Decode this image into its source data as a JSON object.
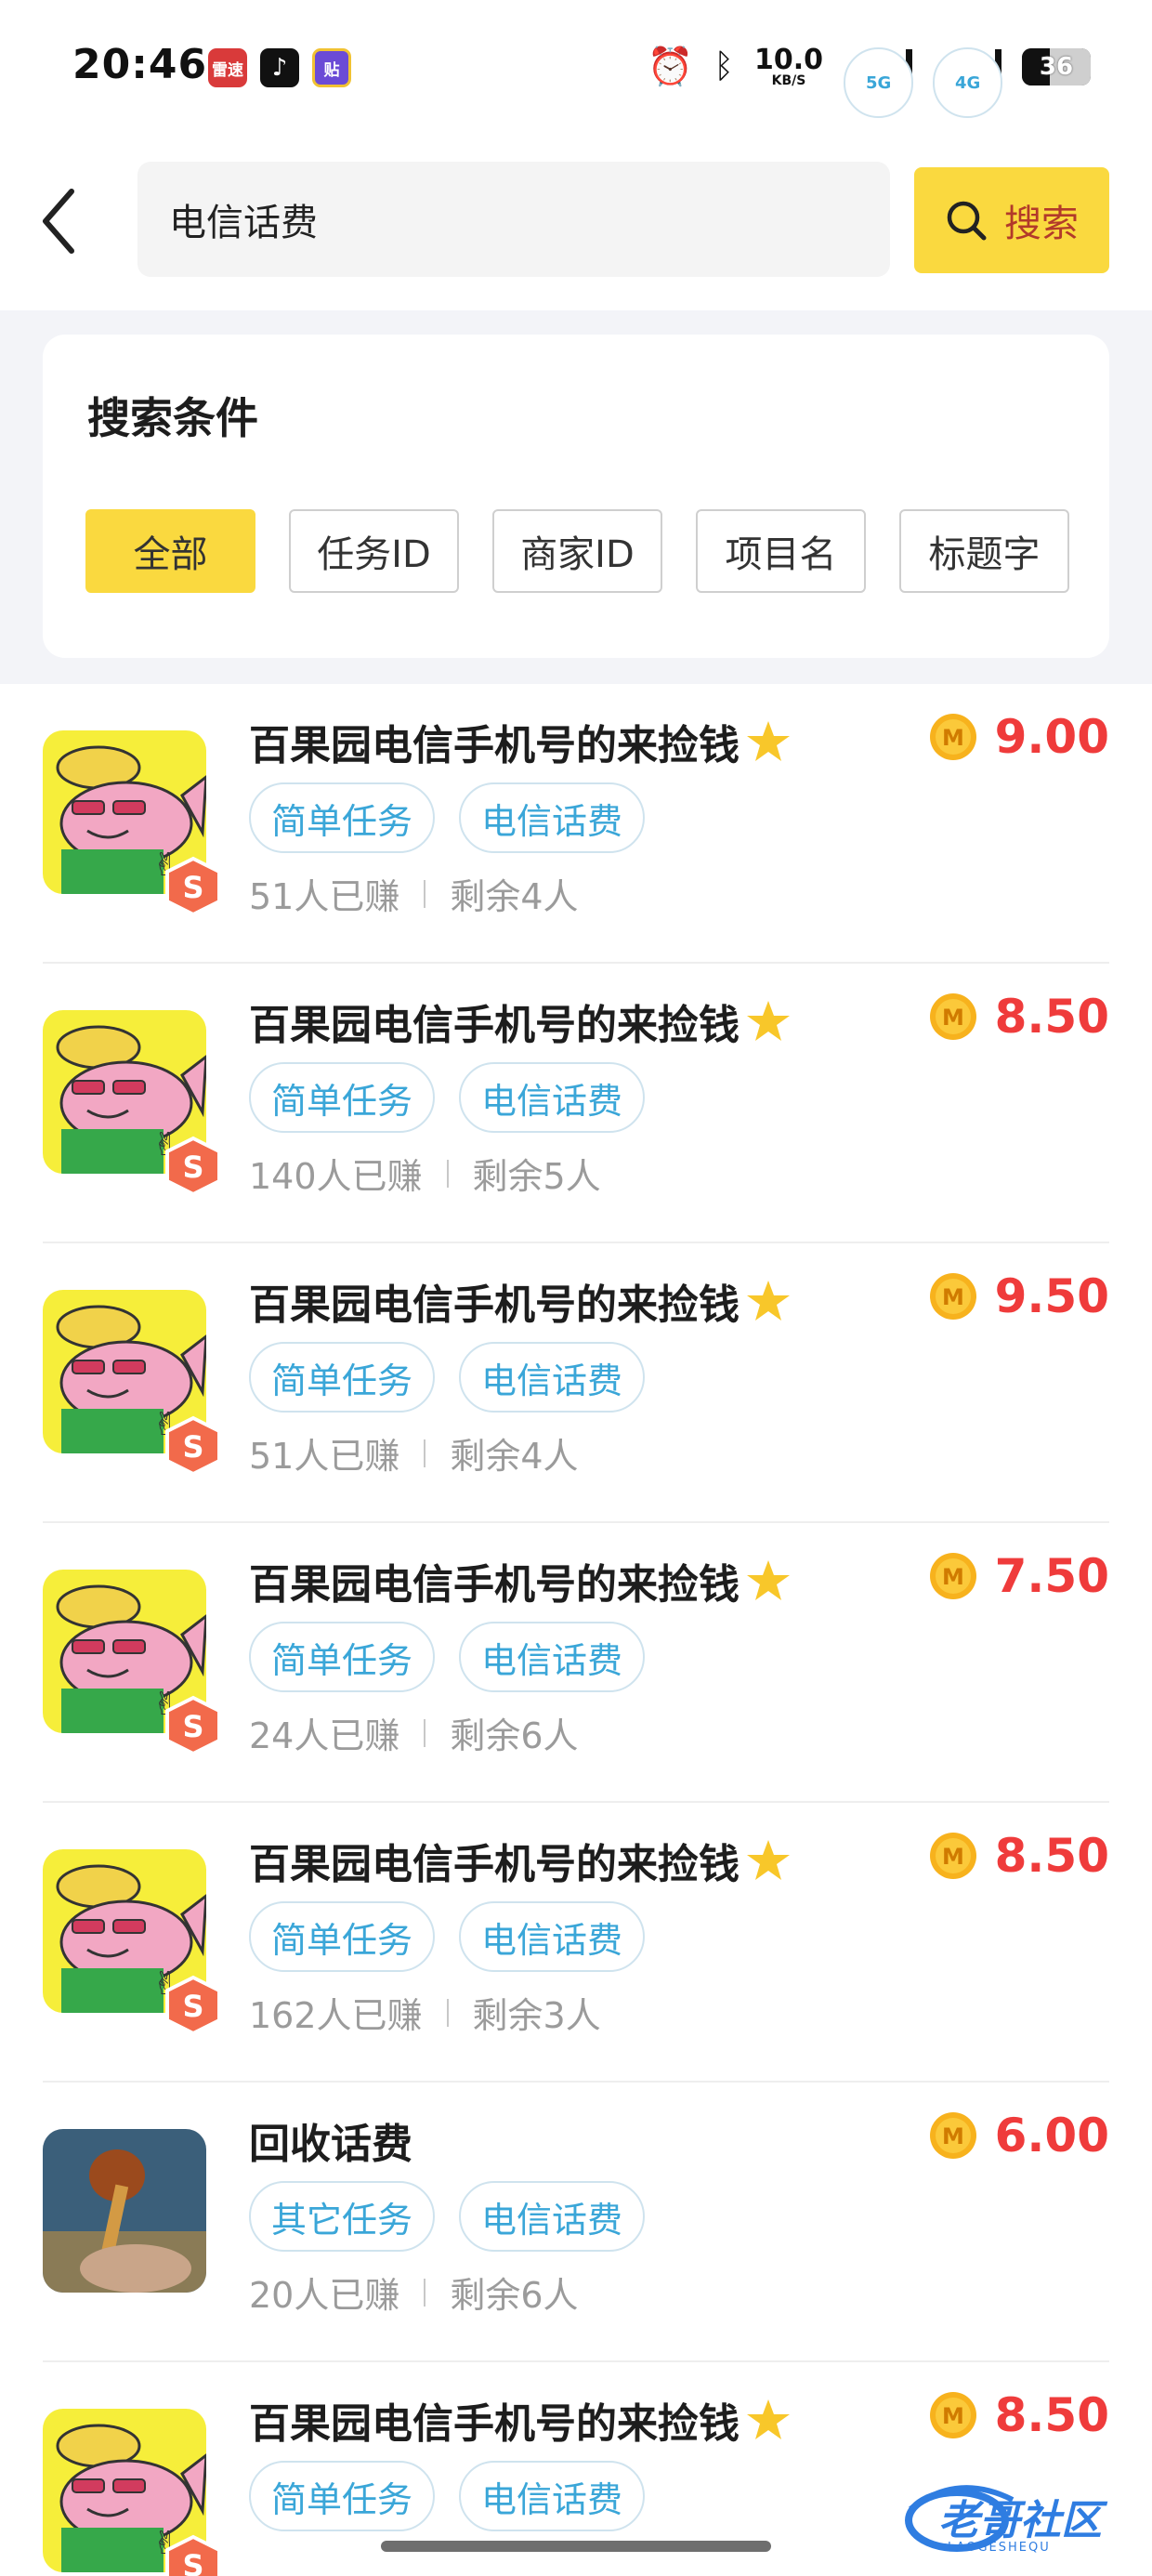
{
  "status_bar": {
    "time": "20:46",
    "apps": [
      {
        "name": "leitingapp",
        "label": "雷速"
      },
      {
        "name": "tiktok",
        "label": "♪"
      },
      {
        "name": "tie",
        "label": "贴"
      }
    ],
    "net_speed": "10.0",
    "net_unit": "KB/S",
    "sig1": "5G",
    "sig2": "4G",
    "battery": "36"
  },
  "search": {
    "query": "电信话费",
    "button_label": "搜索"
  },
  "filter": {
    "title": "搜索条件",
    "chips": [
      "全部",
      "任务ID",
      "商家ID",
      "项目名",
      "标题字"
    ]
  },
  "tasks": [
    {
      "title": "百果园电信手机号的来捡钱",
      "star": true,
      "price": "9.00",
      "tags": [
        "简单任务",
        "电信话费"
      ],
      "earned": "51人已赚",
      "remain": "剩余4人",
      "avatar": "fish"
    },
    {
      "title": "百果园电信手机号的来捡钱",
      "star": true,
      "price": "8.50",
      "tags": [
        "简单任务",
        "电信话费"
      ],
      "earned": "140人已赚",
      "remain": "剩余5人",
      "avatar": "fish"
    },
    {
      "title": "百果园电信手机号的来捡钱",
      "star": true,
      "price": "9.50",
      "tags": [
        "简单任务",
        "电信话费"
      ],
      "earned": "51人已赚",
      "remain": "剩余4人",
      "avatar": "fish"
    },
    {
      "title": "百果园电信手机号的来捡钱",
      "star": true,
      "price": "7.50",
      "tags": [
        "简单任务",
        "电信话费"
      ],
      "earned": "24人已赚",
      "remain": "剩余6人",
      "avatar": "fish"
    },
    {
      "title": "百果园电信手机号的来捡钱",
      "star": true,
      "price": "8.50",
      "tags": [
        "简单任务",
        "电信话费"
      ],
      "earned": "162人已赚",
      "remain": "剩余3人",
      "avatar": "fish"
    },
    {
      "title": "回收话费",
      "star": false,
      "price": "6.00",
      "tags": [
        "其它任务",
        "电信话费"
      ],
      "earned": "20人已赚",
      "remain": "剩余6人",
      "avatar": "photo"
    },
    {
      "title": "百果园电信手机号的来捡钱",
      "star": true,
      "price": "8.50",
      "tags": [
        "简单任务",
        "电信话费"
      ],
      "earned": "",
      "remain": "",
      "avatar": "fish"
    }
  ],
  "watermark": {
    "text": "老哥社区",
    "sub": "LAOGESHEQU"
  },
  "colors": {
    "accent": "#fad93f",
    "price": "#ef3b3b",
    "tag": "#3aa6d8"
  }
}
